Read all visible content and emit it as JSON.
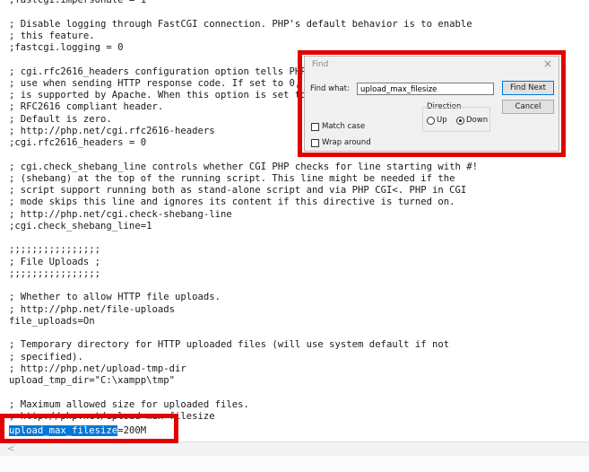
{
  "editor": {
    "lines": [
      ";fastcgi.impersonate = 1",
      "",
      "; Disable logging through FastCGI connection. PHP's default behavior is to enable",
      "; this feature.",
      ";fastcgi.logging = 0",
      "",
      "; cgi.rfc2616_headers configuration option tells PHP what type of headers to",
      "; use when sending HTTP response code. If set to 0, PHP sends Status: header that",
      "; is supported by Apache. When this option is set to 1, PHP will send",
      "; RFC2616 compliant header.",
      "; Default is zero.",
      "; http://php.net/cgi.rfc2616-headers",
      ";cgi.rfc2616_headers = 0",
      "",
      "; cgi.check_shebang_line controls whether CGI PHP checks for line starting with #!",
      "; (shebang) at the top of the running script. This line might be needed if the",
      "; script support running both as stand-alone script and via PHP CGI<. PHP in CGI",
      "; mode skips this line and ignores its content if this directive is turned on.",
      "; http://php.net/cgi.check-shebang-line",
      ";cgi.check_shebang_line=1",
      "",
      ";;;;;;;;;;;;;;;;",
      "; File Uploads ;",
      ";;;;;;;;;;;;;;;;",
      "",
      "; Whether to allow HTTP file uploads.",
      "; http://php.net/file-uploads",
      "file_uploads=On",
      "",
      "; Temporary directory for HTTP uploaded files (will use system default if not",
      "; specified).",
      "; http://php.net/upload-tmp-dir",
      "upload_tmp_dir=\"C:\\xampp\\tmp\"",
      "",
      "; Maximum allowed size for uploaded files.",
      "; http://php.net/upload-max-filesize"
    ],
    "last_line_highlight": "upload_max_filesize",
    "last_line_rest": "=200M"
  },
  "scrollbar": {
    "left_arrow": "<"
  },
  "find_dialog": {
    "title": "Find",
    "close_glyph": "×",
    "find_what_label": "Find what:",
    "find_what_value": "upload_max_filesize",
    "find_next_label": "Find Next",
    "cancel_label": "Cancel",
    "direction_label": "Direction",
    "up_label": "Up",
    "down_label": "Down",
    "direction_selected": "Down",
    "match_case_label": "Match case",
    "match_case_checked": false,
    "wrap_around_label": "Wrap around",
    "wrap_around_checked": false
  },
  "colors": {
    "highlight_bg": "#0078d7",
    "annotation_red": "#e00000"
  }
}
